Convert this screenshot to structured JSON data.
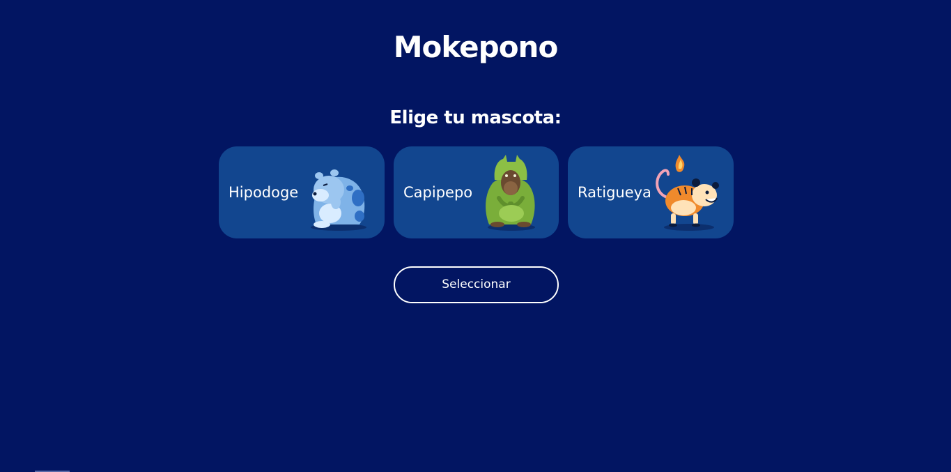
{
  "header": {
    "title": "Mokepono"
  },
  "selection": {
    "prompt": "Elige tu mascota:",
    "pets": [
      {
        "label": "Hipodoge",
        "icon": "hipodoge-image"
      },
      {
        "label": "Capipepo",
        "icon": "capipepo-image"
      },
      {
        "label": "Ratigueya",
        "icon": "ratigueya-image"
      }
    ],
    "button_label": "Seleccionar"
  },
  "colors": {
    "background": "#021562",
    "card": "#12468f",
    "text": "#ffffff"
  }
}
